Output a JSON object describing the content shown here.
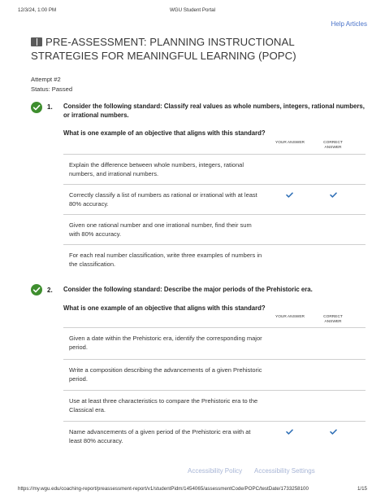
{
  "print_header": {
    "datetime": "12/3/24, 1:00 PM",
    "title": "WGU Student Portal"
  },
  "help_link": "Help Articles",
  "title": "PRE-ASSESSMENT: PLANNING INSTRUCTIONAL STRATEGIES FOR MEANINGFUL LEARNING (POPC)",
  "attempt": "Attempt #2",
  "status": "Status: Passed",
  "col_your": "YOUR ANSWER",
  "col_correct": "CORRECT ANSWER",
  "questions": [
    {
      "number": "1.",
      "standard": "Consider the following standard: Classify real values as whole numbers, integers, rational numbers, or irrational numbers.",
      "prompt": "What is one example of an objective that aligns with this standard?",
      "options": [
        {
          "text": "Explain the difference between whole numbers, integers, rational numbers, and irrational numbers.",
          "your": false,
          "correct": false
        },
        {
          "text": "Correctly classify a list of numbers as rational or irrational with at least 80% accuracy.",
          "your": true,
          "correct": true
        },
        {
          "text": "Given one rational number and one irrational number, find their sum with 80% accuracy.",
          "your": false,
          "correct": false
        },
        {
          "text": "For each real number classification, write three examples of numbers in the classification.",
          "your": false,
          "correct": false
        }
      ]
    },
    {
      "number": "2.",
      "standard": "Consider the following standard: Describe the major periods of the Prehistoric era.",
      "prompt": "What is one example of an objective that aligns with this standard?",
      "options": [
        {
          "text": "Given a date within the Prehistoric era, identify the corresponding major period.",
          "your": false,
          "correct": false
        },
        {
          "text": "Write a composition describing the advancements of a given Prehistoric period.",
          "your": false,
          "correct": false
        },
        {
          "text": "Use at least three characteristics to compare the Prehistoric era to the Classical era.",
          "your": false,
          "correct": false
        },
        {
          "text": "Name advancements of a given period of the Prehistoric era with at least 80% accuracy.",
          "your": true,
          "correct": true
        }
      ]
    }
  ],
  "footer_links": [
    "Accessibility Policy",
    "Accessibility Settings"
  ],
  "print_footer": {
    "url": "https://my.wgu.edu/coaching-report/preassessment-report/v1/studentPidm/1454065/assessmentCode/POPC/testDate/1733258100",
    "page": "1/15"
  },
  "colors": {
    "link": "#4a73c9",
    "check_green": "#3e8e2e",
    "mark_blue": "#2c6db5"
  },
  "icons": {
    "title": "book-icon",
    "question": "checkmark-circle-icon",
    "answer": "checkmark-icon"
  }
}
